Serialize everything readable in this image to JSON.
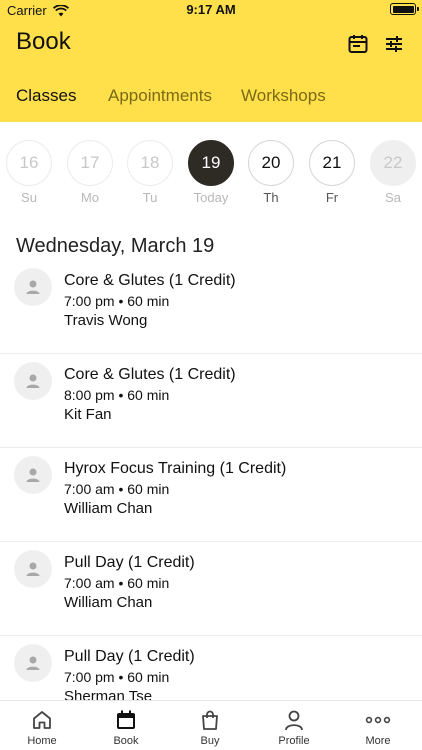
{
  "status_bar": {
    "carrier": "Carrier",
    "time": "9:17 AM"
  },
  "header": {
    "title": "Book",
    "actions": [
      {
        "icon": "calendar-icon"
      },
      {
        "icon": "filter-sliders-icon"
      }
    ]
  },
  "tabs": [
    {
      "label": "Classes",
      "active": true
    },
    {
      "label": "Appointments",
      "active": false
    },
    {
      "label": "Workshops",
      "active": false
    }
  ],
  "date_strip": [
    {
      "day": "16",
      "label": "Su",
      "state": "past"
    },
    {
      "day": "17",
      "label": "Mo",
      "state": "past"
    },
    {
      "day": "18",
      "label": "Tu",
      "state": "past"
    },
    {
      "day": "19",
      "label": "Today",
      "state": "selected"
    },
    {
      "day": "20",
      "label": "Th",
      "state": "future"
    },
    {
      "day": "21",
      "label": "Fr",
      "state": "future"
    },
    {
      "day": "22",
      "label": "Sa",
      "state": "disabled"
    }
  ],
  "date_heading": "Wednesday, March 19",
  "classes": [
    {
      "name": "Core & Glutes (1 Credit)",
      "time": "7:00 pm • 60 min",
      "instructor": "Travis Wong"
    },
    {
      "name": "Core & Glutes (1 Credit)",
      "time": "8:00 pm • 60 min",
      "instructor": "Kit Fan"
    },
    {
      "name": "Hyrox Focus Training (1 Credit)",
      "time": "7:00 am • 60 min",
      "instructor": "William Chan"
    },
    {
      "name": "Pull Day (1 Credit)",
      "time": "7:00 am • 60 min",
      "instructor": "William Chan"
    },
    {
      "name": "Pull Day (1 Credit)",
      "time": "7:00 pm • 60 min",
      "instructor": "Sherman Tse"
    }
  ],
  "tabbar": [
    {
      "label": "Home",
      "icon": "home-icon"
    },
    {
      "label": "Book",
      "icon": "calendar-icon"
    },
    {
      "label": "Buy",
      "icon": "shopping-bag-icon"
    },
    {
      "label": "Profile",
      "icon": "person-icon"
    },
    {
      "label": "More",
      "icon": "more-dots-icon"
    }
  ],
  "colors": {
    "header_bg": "#ffe04a",
    "selected_day": "#2e2a24",
    "inactive_tab": "#7a6a14"
  }
}
